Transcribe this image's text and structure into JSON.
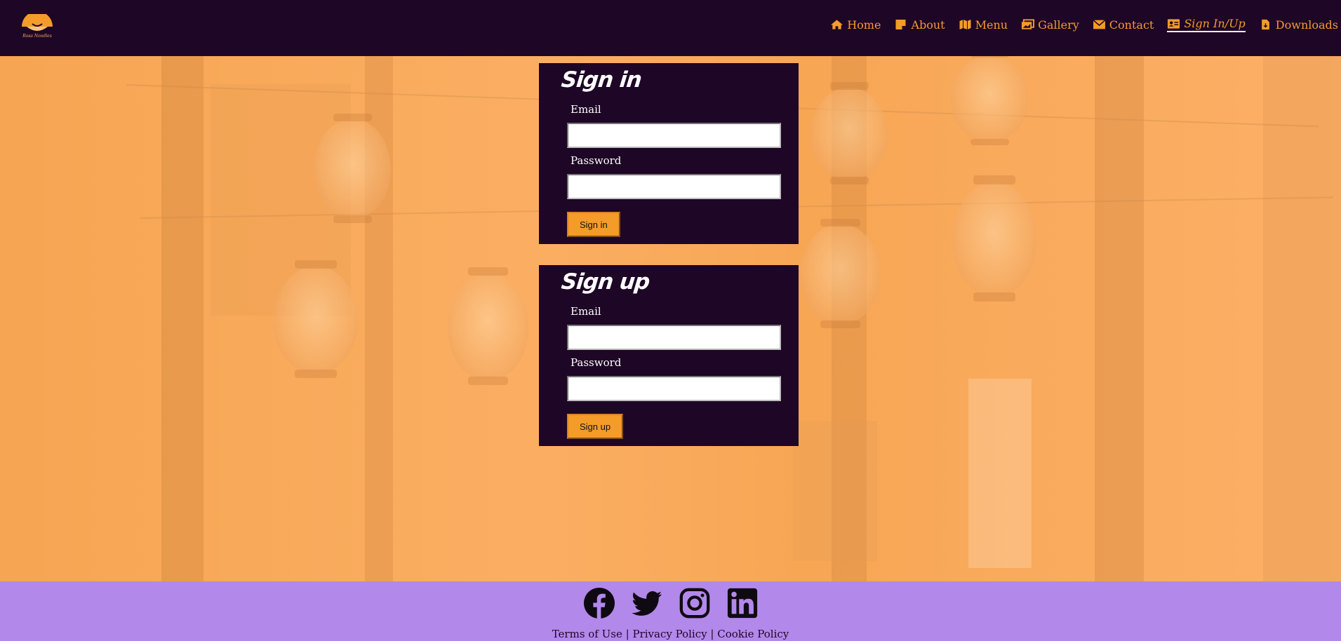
{
  "brand": {
    "logo_text": "Rosa Noodles",
    "accent": "#f59b29",
    "header_bg": "#1e0626",
    "footer_bg": "#b388eb"
  },
  "nav": {
    "items": [
      {
        "label": "Home",
        "icon": "home-icon"
      },
      {
        "label": "About",
        "icon": "note-icon"
      },
      {
        "label": "Menu",
        "icon": "map-icon"
      },
      {
        "label": "Gallery",
        "icon": "images-icon"
      },
      {
        "label": "Contact",
        "icon": "envelope-icon"
      },
      {
        "label": "Sign In/Up",
        "icon": "id-card-icon",
        "active": true
      },
      {
        "label": "Downloads",
        "icon": "file-download-icon"
      }
    ]
  },
  "signin": {
    "title": "Sign in",
    "email_label": "Email",
    "email_value": "",
    "password_label": "Password",
    "password_value": "",
    "button": "Sign in"
  },
  "signup": {
    "title": "Sign up",
    "email_label": "Email",
    "email_value": "",
    "password_label": "Password",
    "password_value": "",
    "button": "Sign up"
  },
  "footer": {
    "social": [
      "facebook-icon",
      "twitter-icon",
      "instagram-icon",
      "linkedin-icon"
    ],
    "terms": "Terms of Use",
    "privacy": "Privacy Policy",
    "cookie": "Cookie Policy",
    "separator": "|"
  }
}
